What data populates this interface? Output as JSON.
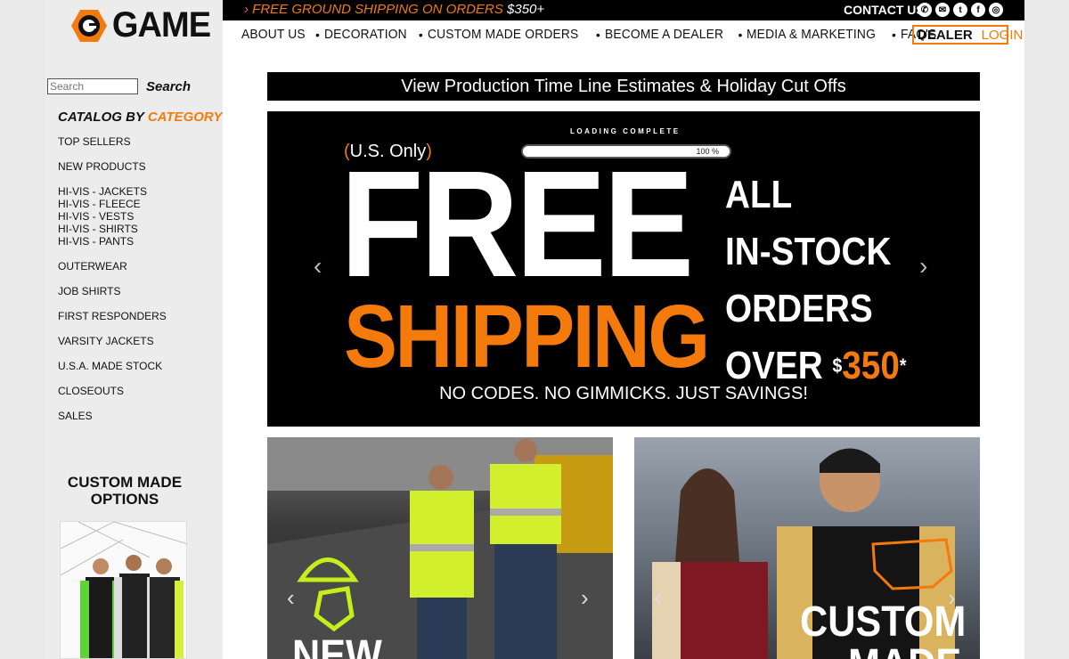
{
  "brand": {
    "name": "GAME",
    "accent": "#f47a0c"
  },
  "topbar": {
    "promo_prefix": "› FREE GROUND SHIPPING ON ORDERS",
    "promo_amount": "$350+",
    "contact_label": "CONTACT US",
    "social_icons": [
      "whatsapp-icon",
      "email-icon",
      "twitter-icon",
      "facebook-icon",
      "instagram-icon"
    ]
  },
  "nav": {
    "items": [
      "ABOUT US",
      "DECORATION",
      "CUSTOM MADE ORDERS",
      "BECOME A DEALER",
      "MEDIA & MARKETING",
      "FAQ'S"
    ],
    "dealer_label": "DEALER",
    "login_label": "LOGIN"
  },
  "search": {
    "placeholder": "Search",
    "value": "Search",
    "button": "Search"
  },
  "catalog": {
    "heading_prefix": "CATALOG BY",
    "heading_accent": "CATEGORY",
    "groups": [
      [
        "TOP SELLERS"
      ],
      [
        "NEW PRODUCTS"
      ],
      [
        "HI-VIS - JACKETS",
        "HI-VIS - FLEECE",
        "HI-VIS - VESTS",
        "HI-VIS - SHIRTS",
        "HI-VIS - PANTS"
      ],
      [
        "OUTERWEAR"
      ],
      [
        "JOB SHIRTS"
      ],
      [
        "FIRST RESPONDERS"
      ],
      [
        "VARSITY JACKETS"
      ],
      [
        "U.S.A. MADE STOCK"
      ],
      [
        "CLOSEOUTS"
      ],
      [
        "SALES"
      ]
    ]
  },
  "custom_made": {
    "title_line1": "CUSTOM MADE",
    "title_line2": "OPTIONS"
  },
  "timeline_bar": {
    "text": "View Production Time Line Estimates & Holiday Cut Offs"
  },
  "hero": {
    "loading_label": "LOADING COMPLETE",
    "progress_value": 100,
    "progress_text": "100 %",
    "us_open": "(",
    "us_text": "U.S. Only",
    "us_close": ")",
    "free": "FREE",
    "shipping": "SHIPPING",
    "line1": "ALL",
    "line2": "IN-STOCK",
    "line3": "ORDERS",
    "over": "OVER ",
    "dollar": "$",
    "amount": "350",
    "asterisk": "*",
    "nocodes": "NO CODES. NO GIMMICKS. JUST SAVINGS!"
  },
  "tiles": {
    "left_caption": "NEW",
    "right_caption_line1": "CUSTOM",
    "right_caption_line2": "MADE"
  }
}
